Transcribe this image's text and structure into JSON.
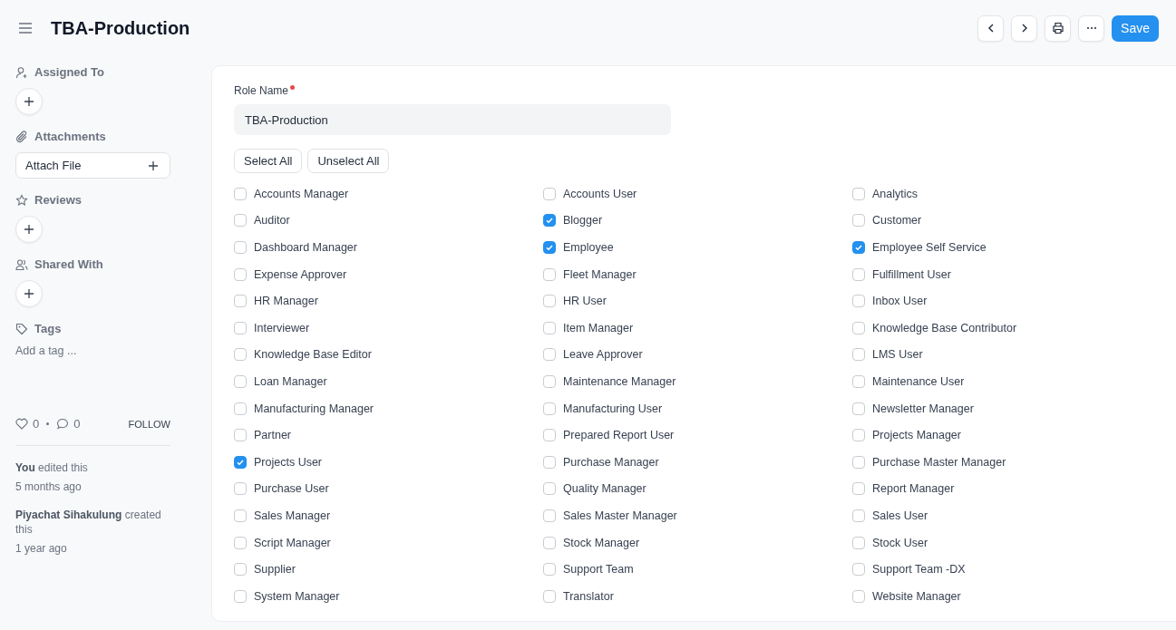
{
  "page": {
    "title": "TBA-Production",
    "primary_button": "Save"
  },
  "sidebar": {
    "assigned_to": {
      "label": "Assigned To"
    },
    "attachments": {
      "label": "Attachments",
      "button": "Attach File"
    },
    "reviews": {
      "label": "Reviews"
    },
    "shared_with": {
      "label": "Shared With"
    },
    "tags": {
      "label": "Tags",
      "placeholder": "Add a tag ..."
    },
    "likes": "0",
    "comments": "0",
    "follow": "FOLLOW",
    "activity": [
      {
        "text": "**You** edited this",
        "time": "5 months ago"
      },
      {
        "text": "**Piyachat Sihakulung** created this",
        "time": "1 year ago"
      }
    ]
  },
  "form": {
    "role_name": {
      "label": "Role Name",
      "required": true,
      "value": "TBA-Production"
    },
    "buttons": [
      "Select All",
      "Unselect All"
    ],
    "roles": [
      {
        "label": "Accounts Manager",
        "checked": false
      },
      {
        "label": "Accounts User",
        "checked": false
      },
      {
        "label": "Analytics",
        "checked": false
      },
      {
        "label": "Auditor",
        "checked": false
      },
      {
        "label": "Blogger",
        "checked": true
      },
      {
        "label": "Customer",
        "checked": false
      },
      {
        "label": "Dashboard Manager",
        "checked": false
      },
      {
        "label": "Employee",
        "checked": true
      },
      {
        "label": "Employee Self Service",
        "checked": true
      },
      {
        "label": "Expense Approver",
        "checked": false
      },
      {
        "label": "Fleet Manager",
        "checked": false
      },
      {
        "label": "Fulfillment User",
        "checked": false
      },
      {
        "label": "HR Manager",
        "checked": false
      },
      {
        "label": "HR User",
        "checked": false
      },
      {
        "label": "Inbox User",
        "checked": false
      },
      {
        "label": "Interviewer",
        "checked": false
      },
      {
        "label": "Item Manager",
        "checked": false
      },
      {
        "label": "Knowledge Base Contributor",
        "checked": false
      },
      {
        "label": "Knowledge Base Editor",
        "checked": false
      },
      {
        "label": "Leave Approver",
        "checked": false
      },
      {
        "label": "LMS User",
        "checked": false
      },
      {
        "label": "Loan Manager",
        "checked": false
      },
      {
        "label": "Maintenance Manager",
        "checked": false
      },
      {
        "label": "Maintenance User",
        "checked": false
      },
      {
        "label": "Manufacturing Manager",
        "checked": false
      },
      {
        "label": "Manufacturing User",
        "checked": false
      },
      {
        "label": "Newsletter Manager",
        "checked": false
      },
      {
        "label": "Partner",
        "checked": false
      },
      {
        "label": "Prepared Report User",
        "checked": false
      },
      {
        "label": "Projects Manager",
        "checked": false
      },
      {
        "label": "Projects User",
        "checked": true
      },
      {
        "label": "Purchase Manager",
        "checked": false
      },
      {
        "label": "Purchase Master Manager",
        "checked": false
      },
      {
        "label": "Purchase User",
        "checked": false
      },
      {
        "label": "Quality Manager",
        "checked": false
      },
      {
        "label": "Report Manager",
        "checked": false
      },
      {
        "label": "Sales Manager",
        "checked": false
      },
      {
        "label": "Sales Master Manager",
        "checked": false
      },
      {
        "label": "Sales User",
        "checked": false
      },
      {
        "label": "Script Manager",
        "checked": false
      },
      {
        "label": "Stock Manager",
        "checked": false
      },
      {
        "label": "Stock User",
        "checked": false
      },
      {
        "label": "Supplier",
        "checked": false
      },
      {
        "label": "Support Team",
        "checked": false
      },
      {
        "label": "Support Team -DX",
        "checked": false
      },
      {
        "label": "System Manager",
        "checked": false
      },
      {
        "label": "Translator",
        "checked": false
      },
      {
        "label": "Website Manager",
        "checked": false
      }
    ]
  }
}
